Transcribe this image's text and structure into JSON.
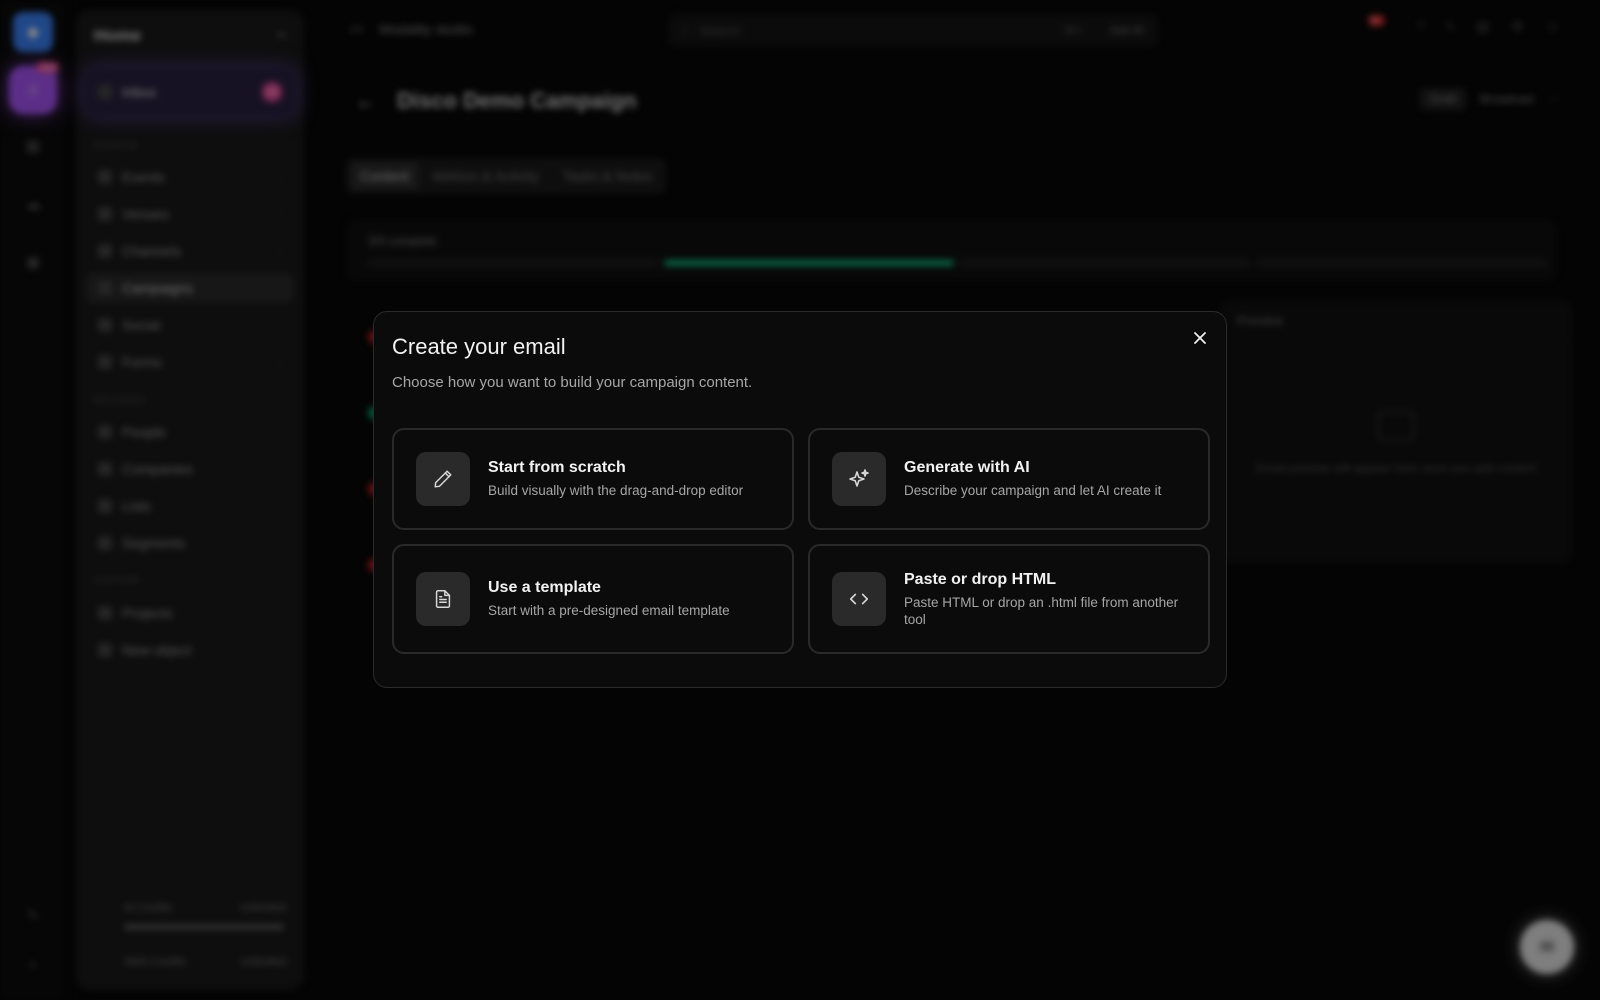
{
  "background": {
    "sidebar": {
      "title": "Home",
      "inbox": {
        "label": "Inbox",
        "badge": "12"
      },
      "section_1": "ENGAGE",
      "items_1": [
        "Events",
        "Venues",
        "Channels",
        "Campaigns",
        "Social",
        "Forms"
      ],
      "section_2": "RECORDS",
      "items_2": [
        "People",
        "Companies",
        "Lists",
        "Segments"
      ],
      "section_3": "CUSTOM",
      "items_3": [
        "Projects",
        "New object"
      ],
      "footer_1": {
        "label": "AI Credits",
        "value": "Unlimited"
      },
      "footer_2": {
        "label": "SMS Credits",
        "value": "Unlimited"
      }
    },
    "topbar": {
      "workspace": "Modality studio",
      "search_placeholder": "Search",
      "search_kbd": "⌘K",
      "ask_ai": "Ask AI",
      "notification_badge": "9+"
    },
    "page": {
      "title": "Disco Demo Campaign",
      "status": "Draft",
      "action": "Broadcast",
      "tabs": [
        "Content",
        "Metrics & Activity",
        "Tasks & Notes"
      ],
      "progress_label": "3/4 complete",
      "progress_fraction": 0.5,
      "preview_title": "Preview",
      "preview_empty": "Email preview will appear here once you add content"
    }
  },
  "modal": {
    "title": "Create your email",
    "subtitle": "Choose how you want to build your campaign content.",
    "options": [
      {
        "title": "Start from scratch",
        "description": "Build visually with the drag-and-drop editor",
        "icon": "pencil-icon"
      },
      {
        "title": "Generate with AI",
        "description": "Describe your campaign and let AI create it",
        "icon": "sparkles-icon"
      },
      {
        "title": "Use a template",
        "description": "Start with a pre-designed email template",
        "icon": "document-icon"
      },
      {
        "title": "Paste or drop HTML",
        "description": "Paste HTML or drop an .html file from another tool",
        "icon": "code-icon"
      }
    ]
  }
}
